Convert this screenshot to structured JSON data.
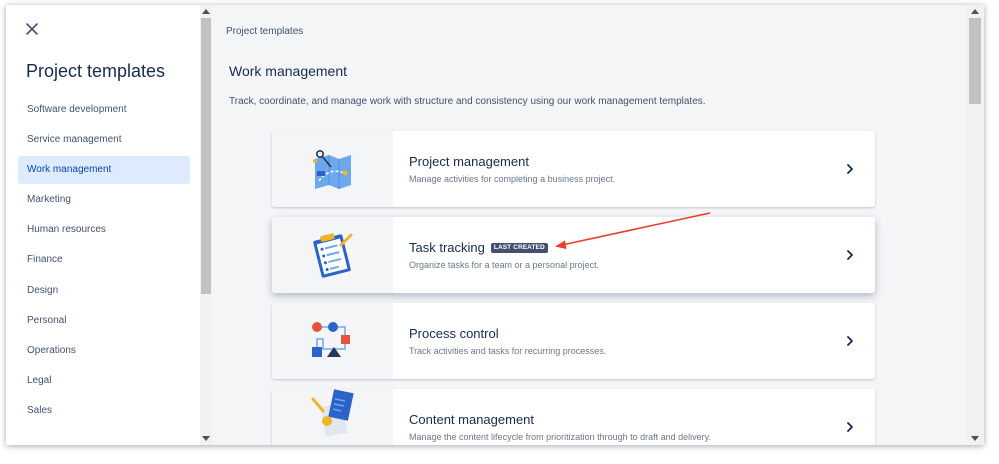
{
  "sidebar": {
    "title": "Project templates",
    "items": [
      {
        "label": "Software development",
        "active": false
      },
      {
        "label": "Service management",
        "active": false
      },
      {
        "label": "Work management",
        "active": true
      },
      {
        "label": "Marketing",
        "active": false
      },
      {
        "label": "Human resources",
        "active": false
      },
      {
        "label": "Finance",
        "active": false
      },
      {
        "label": "Design",
        "active": false
      },
      {
        "label": "Personal",
        "active": false
      },
      {
        "label": "Operations",
        "active": false
      },
      {
        "label": "Legal",
        "active": false
      },
      {
        "label": "Sales",
        "active": false
      }
    ]
  },
  "main": {
    "breadcrumb": "Project templates",
    "title": "Work management",
    "description": "Track, coordinate, and manage work with structure and consistency using our work management templates.",
    "cards": [
      {
        "name": "Project management",
        "description": "Manage activities for completing a business project.",
        "badge": ""
      },
      {
        "name": "Task tracking",
        "description": "Organize tasks for a team or a personal project.",
        "badge": "LAST CREATED"
      },
      {
        "name": "Process control",
        "description": "Track activities and tasks for recurring processes.",
        "badge": ""
      },
      {
        "name": "Content management",
        "description": "Manage the content lifecycle from prioritization through to draft and delivery.",
        "badge": ""
      }
    ]
  },
  "icons": {
    "close": "close-icon",
    "chevron": "chevron-right-icon",
    "card_icons": [
      "roadmap-illustration-icon",
      "clipboard-checklist-icon",
      "process-flow-icon",
      "content-document-icon"
    ]
  },
  "colors": {
    "active_bg": "#deebff",
    "active_text": "#0747a6",
    "badge_bg": "#42526e",
    "annotation_arrow": "#e5412d"
  }
}
